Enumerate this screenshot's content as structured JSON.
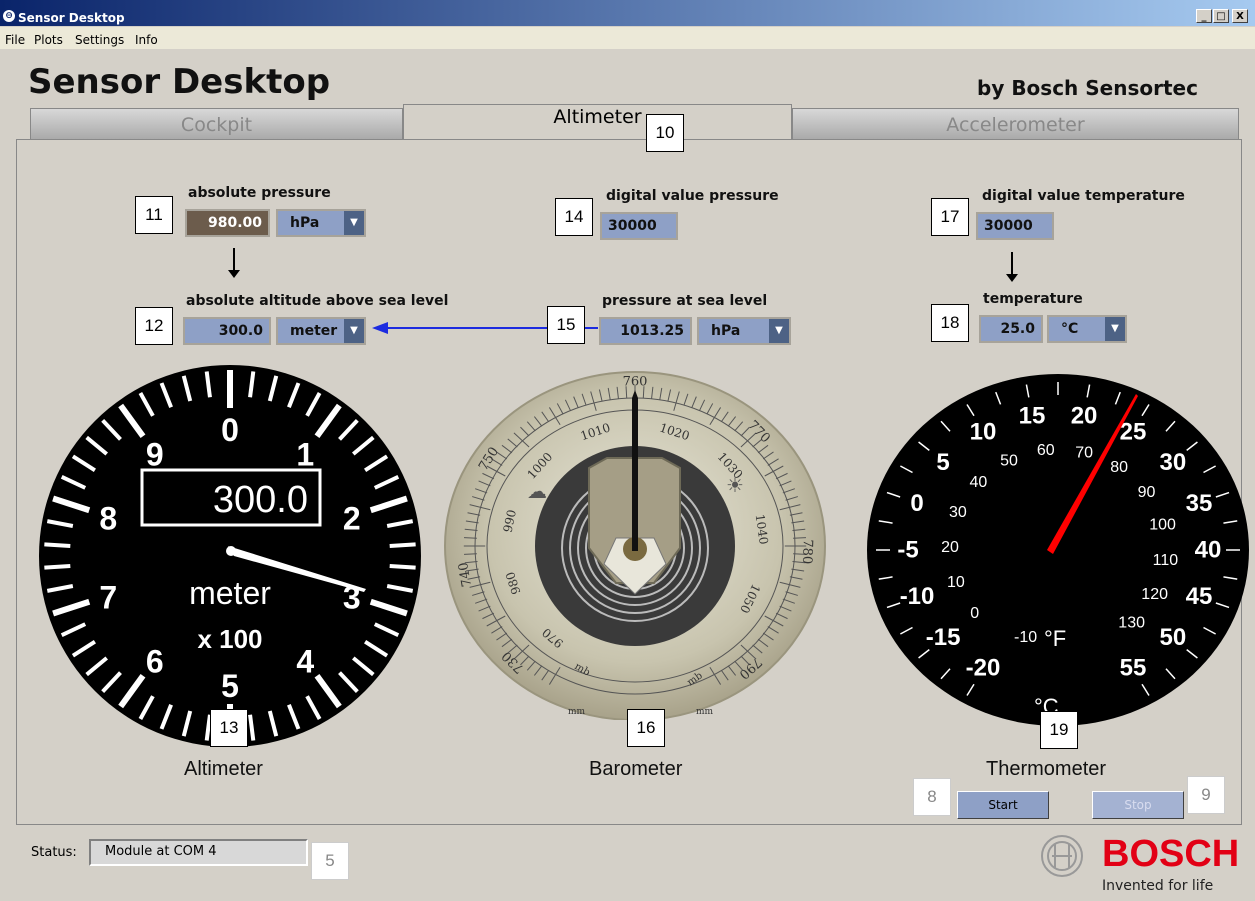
{
  "window": {
    "title": "Sensor Desktop",
    "min_btn": "_",
    "max_btn": "□",
    "close_btn": "X"
  },
  "menu": [
    "File",
    "Plots",
    "Settings",
    "Info"
  ],
  "header": {
    "app_title": "Sensor Desktop",
    "byline": "by Bosch Sensortec"
  },
  "tabs": [
    {
      "label": "Cockpit",
      "active": false
    },
    {
      "label": "Altimeter",
      "active": true
    },
    {
      "label": "Accelerometer",
      "active": false
    }
  ],
  "callouts": {
    "c5": "5",
    "c8": "8",
    "c9": "9",
    "c10": "10",
    "c11": "11",
    "c12": "12",
    "c13": "13",
    "c14": "14",
    "c15": "15",
    "c16": "16",
    "c17": "17",
    "c18": "18",
    "c19": "19"
  },
  "altimeter": {
    "abs_pressure_label": "absolute pressure",
    "abs_pressure_value": "980.00",
    "abs_pressure_unit": "hPa",
    "altitude_label": "absolute altitude above sea level",
    "altitude_value": "300.0",
    "altitude_unit": "meter",
    "gauge_readout": "300.0",
    "gauge_unit": "meter",
    "gauge_scale": "x 100",
    "gauge_numbers": [
      "0",
      "1",
      "2",
      "3",
      "4",
      "5",
      "6",
      "7",
      "8",
      "9"
    ],
    "caption": "Altimeter"
  },
  "barometer": {
    "digital_label": "digital value pressure",
    "digital_value": "30000",
    "sea_level_label": "pressure at sea level",
    "sea_level_value": "1013.25",
    "sea_level_unit": "hPa",
    "outer_scale": [
      "730",
      "740",
      "750",
      "760",
      "770",
      "780",
      "790"
    ],
    "inner_scale": [
      "970",
      "980",
      "990",
      "1000",
      "1010",
      "1020",
      "1030",
      "1040",
      "1050"
    ],
    "mb_label": "mb",
    "mm_label": "mm",
    "caption": "Barometer"
  },
  "thermometer": {
    "digital_label": "digital value temperature",
    "digital_value": "30000",
    "temp_label": "temperature",
    "temp_value": "25.0",
    "temp_unit": "°C",
    "celsius_scale": [
      "-20",
      "-15",
      "-10",
      "-5",
      "0",
      "5",
      "10",
      "15",
      "20",
      "25",
      "30",
      "35",
      "40",
      "45",
      "50",
      "55"
    ],
    "fahrenheit_scale": [
      "-10",
      "0",
      "10",
      "20",
      "30",
      "40",
      "50",
      "60",
      "70",
      "80",
      "90",
      "100",
      "110",
      "120",
      "130"
    ],
    "f_unit": "°F",
    "c_unit": "°C",
    "caption": "Thermometer"
  },
  "controls": {
    "start": "Start",
    "stop": "Stop"
  },
  "status": {
    "label": "Status:",
    "value": "Module at COM 4"
  },
  "brand": {
    "name": "BOSCH",
    "tagline": "Invented for life",
    "color": "#e20015"
  },
  "colors": {
    "field": "#8ea0c6",
    "dark_field": "#6c5c4c",
    "arrow": "#1c2be0",
    "needle_red": "#ff0000"
  }
}
